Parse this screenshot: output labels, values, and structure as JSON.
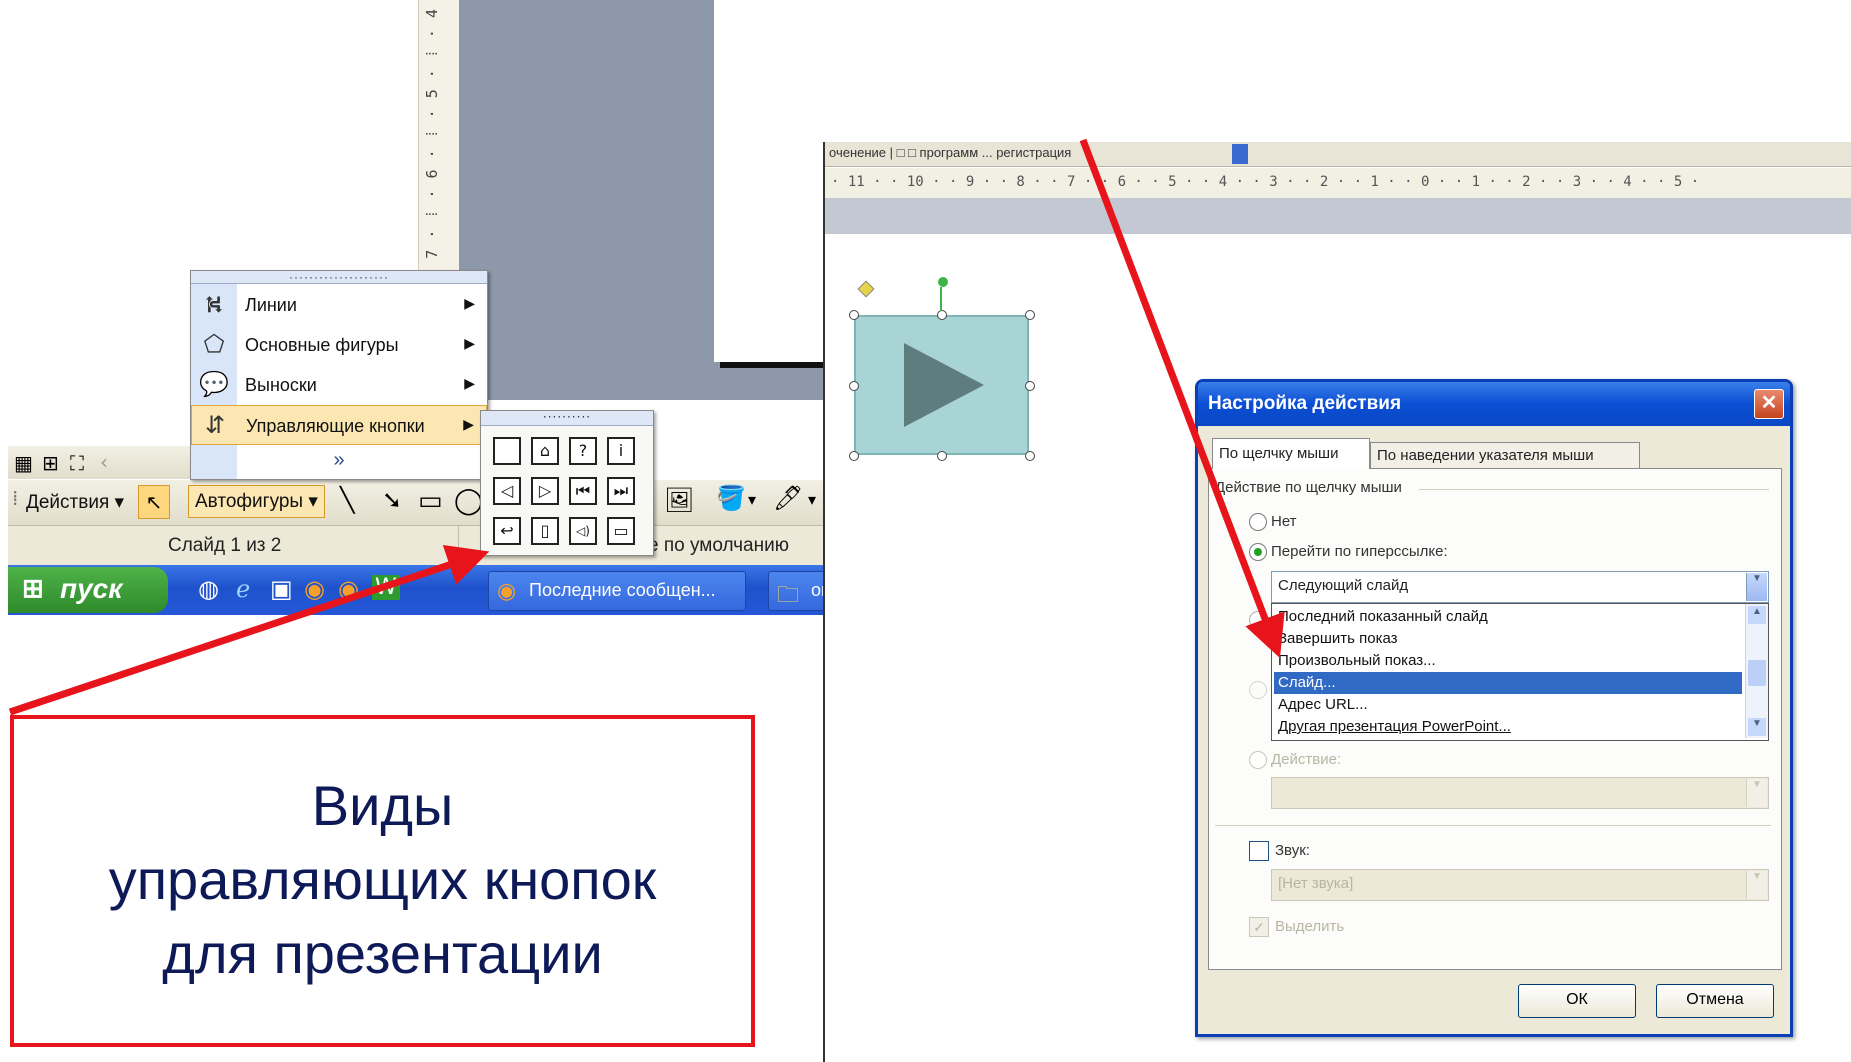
{
  "left_screenshot": {
    "vertical_ruler": "· 8 · ⁞ · 7 · ⁞ · 6 · ⁞ · 5 · ⁞ · 4",
    "menu": {
      "grip": "····················",
      "items": [
        {
          "label": "Линии",
          "icon": "lines-icon",
          "glyph": "⛕"
        },
        {
          "label": "Основные фигуры",
          "icon": "basic-shapes-icon",
          "glyph": "⬠"
        },
        {
          "label": "Выноски",
          "icon": "callouts-icon",
          "glyph": "💬"
        },
        {
          "label": "Управляющие кнопки",
          "icon": "action-buttons-icon",
          "glyph": "⇵"
        }
      ],
      "more_glyph": "»"
    },
    "action_buttons_palette": {
      "grip": "··········",
      "buttons": [
        {
          "name": "custom",
          "glyph": ""
        },
        {
          "name": "home",
          "glyph": "⌂"
        },
        {
          "name": "help",
          "glyph": "?"
        },
        {
          "name": "information",
          "glyph": "i"
        },
        {
          "name": "back",
          "glyph": "◁"
        },
        {
          "name": "forward",
          "glyph": "▷"
        },
        {
          "name": "beginning",
          "glyph": "⏮"
        },
        {
          "name": "end",
          "glyph": "⏭"
        },
        {
          "name": "return",
          "glyph": "↩"
        },
        {
          "name": "document",
          "glyph": "▯"
        },
        {
          "name": "sound",
          "glyph": "◁)"
        },
        {
          "name": "movie",
          "glyph": "▭"
        }
      ]
    },
    "toolbar": {
      "actions_label": "Действия",
      "autoshapes_label": "Автофигуры",
      "dropdown": "▾"
    },
    "status_bar": {
      "slide_counter": "Слайд 1 из 2",
      "design": "е по умолчанию"
    },
    "taskbar": {
      "start_label": "пуск",
      "task1": "Последние сообщен...",
      "task2": "or"
    }
  },
  "right_screenshot": {
    "title_fragments": "оченение  |  □ □ программ ... регистрация",
    "ruler": "· 11 · · 10 · · 9 · · 8 · · 7 · · 6 · · 5 · · 4 · · 3 · · 2 · · 1 · · 0 · · 1 · · 2 · · 3 · · 4 · · 5 ·",
    "dialog": {
      "title": "Настройка действия",
      "close": "✕",
      "tab_active": "По щелчку мыши",
      "tab_inactive": "По наведении указателя мыши",
      "group_label": "Действие по щелчку мыши",
      "radio_none": "Нет",
      "radio_hyperlink": "Перейти по гиперссылке:",
      "hyperlink_value": "Следующий слайд",
      "list_items": [
        "Последний показанный слайд",
        "Завершить показ",
        "Произвольный показ...",
        "Слайд...",
        "Адрес URL...",
        "Другая презентация PowerPoint..."
      ],
      "selected_index": 3,
      "radio_action": "Действие:",
      "sound_label": "Звук:",
      "sound_value": "[Нет звука]",
      "highlight_label": "Выделить",
      "ok": "ОК",
      "cancel": "Отмена"
    }
  },
  "caption": {
    "line1": "Виды",
    "line2": "управляющих кнопок",
    "line3": "для презентации"
  },
  "colors": {
    "arrow": "#e8141b",
    "caption_text": "#0d1a57",
    "caption_border": "#e8141b"
  }
}
